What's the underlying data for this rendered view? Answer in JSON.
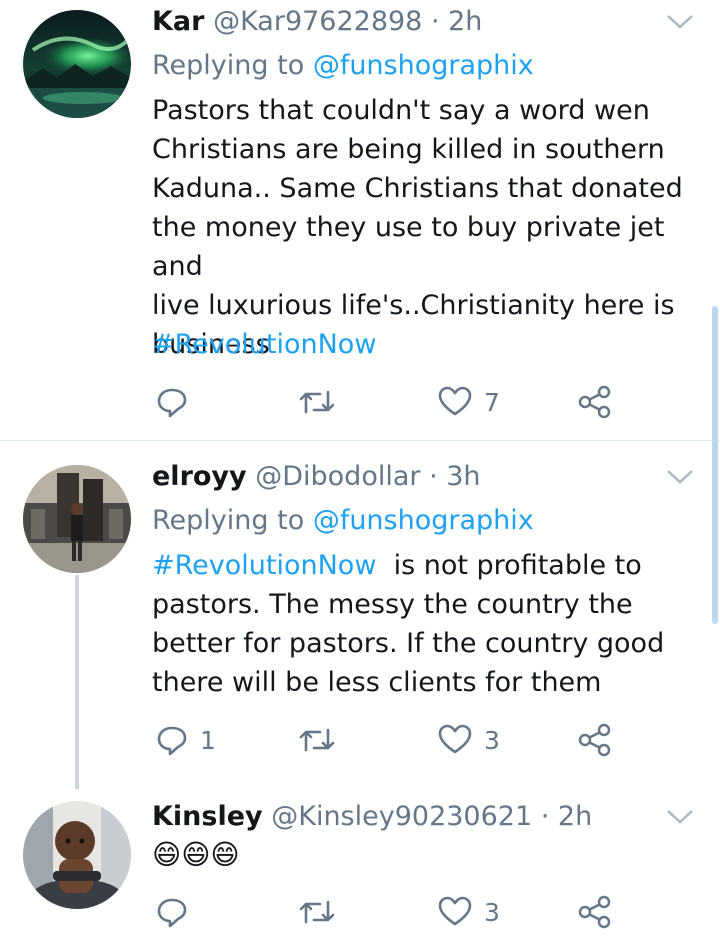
{
  "tweets": [
    {
      "name": "Kar",
      "handle": "@Kar97622898",
      "time": "· 2h",
      "replying_prefix": "Replying to",
      "replying_to": "@funshographix",
      "text": "Pastors that couldn't say a word wen\nChristians are being killed in southern\nKaduna.. Same Christians that donated\nthe money they use to buy private jet and\nlive luxurious life's..Christianity  here is\nbusiness",
      "hashtag": "#RevolutionNow",
      "reply_count": "",
      "retweet_count": "",
      "like_count": "7"
    },
    {
      "name": "elroyy",
      "handle": "@Dibodollar",
      "time": "· 3h",
      "replying_prefix": "Replying to",
      "replying_to": "@funshographix",
      "hashtag": "#RevolutionNow",
      "text_first_line": "  is not profitable to",
      "text": "pastors. The messy the country the\nbetter for pastors. If the country good\nthere will be less clients for them",
      "reply_count": "1",
      "retweet_count": "",
      "like_count": "3"
    },
    {
      "name": "Kinsley",
      "handle": "@Kinsley90230621",
      "time": "· 2h",
      "text": "😄😄😄",
      "reply_count": "",
      "retweet_count": "",
      "like_count": "3"
    }
  ],
  "icons": {
    "reply": "reply-icon",
    "retweet": "retweet-icon",
    "like": "heart-icon",
    "share": "share-icon",
    "more": "chevron-down-icon"
  },
  "colors": {
    "link": "#1da1f2",
    "secondary_text": "#657786",
    "divider": "#e1e8ed"
  }
}
